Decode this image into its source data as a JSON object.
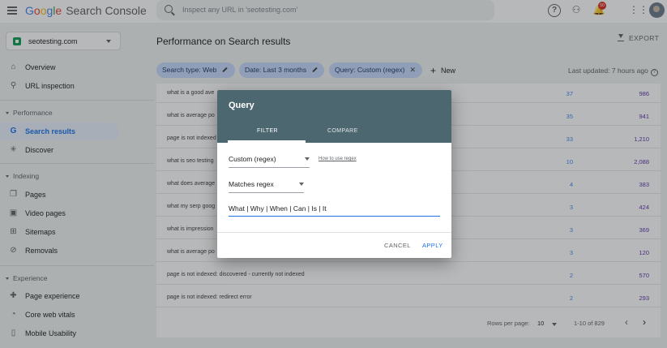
{
  "header": {
    "logo_google": [
      "G",
      "o",
      "o",
      "g",
      "l",
      "e"
    ],
    "logo_product": "Search Console",
    "search_placeholder": "Inspect any URL in 'seotesting.com'",
    "notification_count": "50"
  },
  "property": {
    "name": "seotesting.com"
  },
  "sidebar": {
    "items_top": [
      {
        "label": "Overview",
        "icon": "home-icon",
        "glyph": "⌂"
      },
      {
        "label": "URL inspection",
        "icon": "search-icon",
        "glyph": "⚲"
      }
    ],
    "performance": {
      "title": "Performance",
      "items": [
        {
          "label": "Search results",
          "icon": "google-g-icon",
          "glyph": "G"
        },
        {
          "label": "Discover",
          "icon": "asterisk-icon",
          "glyph": "✳"
        }
      ]
    },
    "indexing": {
      "title": "Indexing",
      "items": [
        {
          "label": "Pages",
          "icon": "pages-icon",
          "glyph": "❐"
        },
        {
          "label": "Video pages",
          "icon": "video-icon",
          "glyph": "▣"
        },
        {
          "label": "Sitemaps",
          "icon": "sitemap-icon",
          "glyph": "⊞"
        },
        {
          "label": "Removals",
          "icon": "removal-icon",
          "glyph": "⊘"
        }
      ]
    },
    "experience": {
      "title": "Experience",
      "items": [
        {
          "label": "Page experience",
          "icon": "page-experience-icon",
          "glyph": "✚"
        },
        {
          "label": "Core web vitals",
          "icon": "gauge-icon",
          "glyph": "◔"
        },
        {
          "label": "Mobile Usability",
          "icon": "phone-icon",
          "glyph": "▯"
        }
      ]
    }
  },
  "main": {
    "title": "Performance on Search results",
    "export_label": "EXPORT",
    "filters": [
      {
        "label": "Search type: Web"
      },
      {
        "label": "Date: Last 3 months"
      },
      {
        "label": "Query: Custom (regex)"
      }
    ],
    "new_label": "New",
    "last_updated": "Last updated: 7 hours ago"
  },
  "table": {
    "rows": [
      {
        "query": "what is a good ave",
        "clicks": "37",
        "impressions": "986"
      },
      {
        "query": "what is average po",
        "clicks": "35",
        "impressions": "941"
      },
      {
        "query": "page is not indexed",
        "clicks": "33",
        "impressions": "1,210"
      },
      {
        "query": "what is seo testing",
        "clicks": "10",
        "impressions": "2,088"
      },
      {
        "query": "what does average",
        "clicks": "4",
        "impressions": "383"
      },
      {
        "query": "what my serp goog",
        "clicks": "3",
        "impressions": "424"
      },
      {
        "query": "what is impression",
        "clicks": "3",
        "impressions": "369"
      },
      {
        "query": "what is average po",
        "clicks": "3",
        "impressions": "120"
      },
      {
        "query": "page is not indexed: discovered - currently not indexed",
        "clicks": "2",
        "impressions": "570"
      },
      {
        "query": "page is not indexed: redirect error",
        "clicks": "2",
        "impressions": "293"
      }
    ],
    "pager": {
      "rows_per_page_label": "Rows per page:",
      "rows_per_page_value": "10",
      "range": "1-10 of 829"
    }
  },
  "dialog": {
    "title": "Query",
    "tabs": [
      "FILTER",
      "COMPARE"
    ],
    "filter_type": "Custom (regex)",
    "help_link": "How to use regex",
    "match_mode": "Matches regex",
    "regex_value": "What | Why | When | Can | Is | It",
    "cancel_label": "CANCEL",
    "apply_label": "APPLY"
  },
  "colors": {
    "accent": "#1a73e8",
    "dialog_header": "#4d6770",
    "chip": "#c6dafc",
    "clicks": "#4285f4",
    "impressions": "#5e35b1"
  }
}
